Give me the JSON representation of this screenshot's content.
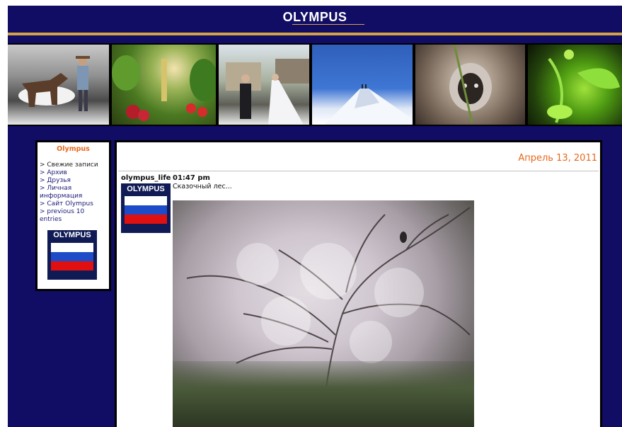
{
  "header": {
    "logo_text": "OLYMPUS"
  },
  "banner": {
    "photos": [
      "cowboy-horse-photo",
      "vegetables-photo",
      "wedding-photo",
      "mountain-photo",
      "monkey-photo",
      "plant-photo"
    ]
  },
  "sidebar": {
    "title": "Olympus",
    "items": [
      {
        "label": "> Свежие записи"
      },
      {
        "label": "> Архив"
      },
      {
        "label": "> Друзья"
      },
      {
        "label": "> Личная информация"
      },
      {
        "label": "> Сайт Olympus"
      },
      {
        "label": "> previous 10 entries"
      }
    ],
    "badge_text": "OLYMPUS"
  },
  "post": {
    "date": "Апрель 13, 2011",
    "user": "olympus_life",
    "time": "01:47 pm",
    "text": "Сказочный лес...",
    "userpic_text": "OLYMPUS"
  },
  "colors": {
    "background": "#110c64",
    "accent_gold": "#d3a34a",
    "date_orange": "#e8671c"
  }
}
